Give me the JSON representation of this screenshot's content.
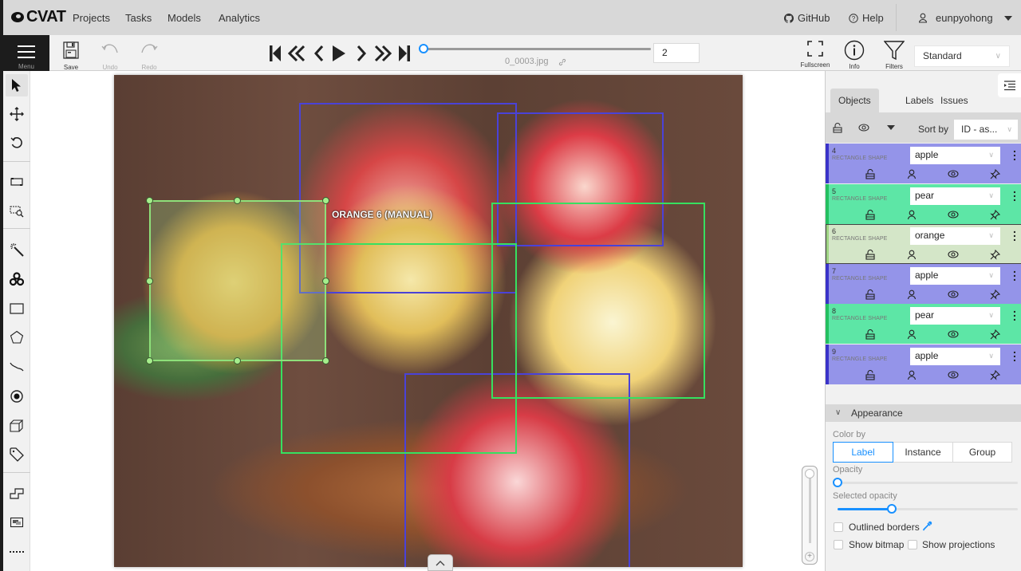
{
  "header": {
    "logo": "CVAT",
    "nav": [
      "Projects",
      "Tasks",
      "Models",
      "Analytics"
    ],
    "github": "GitHub",
    "help": "Help",
    "user": "eunpyohong"
  },
  "toolbar": {
    "menu_label": "Menu",
    "save_label": "Save",
    "undo_label": "Undo",
    "redo_label": "Redo",
    "frame_name": "0_0003.jpg",
    "frame_number": "2",
    "frame_progress_fraction": 0.0,
    "fullscreen_label": "Fullscreen",
    "info_label": "Info",
    "filters_label": "Filters",
    "workspace": "Standard"
  },
  "canvas": {
    "selected_label_text": "ORANGE 6 (MANUAL)",
    "colors": {
      "apple": "#4a42d8",
      "pear": "#36e060",
      "orange": "#8ee07a"
    }
  },
  "sidebar": {
    "tabs": [
      "Objects",
      "Labels",
      "Issues"
    ],
    "active_tab": "Objects",
    "sort_by_label": "Sort by",
    "sort_by_value": "ID - as...",
    "objects": [
      {
        "id": "4",
        "type": "RECTANGLE SHAPE",
        "label": "apple",
        "color": "#9494e9",
        "border": "#3a33c9"
      },
      {
        "id": "5",
        "type": "RECTANGLE SHAPE",
        "label": "pear",
        "color": "#5de6a6",
        "border": "#24c060"
      },
      {
        "id": "6",
        "type": "RECTANGLE SHAPE",
        "label": "orange",
        "color": "#d4e6c8",
        "border": "#9ed483"
      },
      {
        "id": "7",
        "type": "RECTANGLE SHAPE",
        "label": "apple",
        "color": "#9494e9",
        "border": "#3a33c9"
      },
      {
        "id": "8",
        "type": "RECTANGLE SHAPE",
        "label": "pear",
        "color": "#5de6a6",
        "border": "#24c060"
      },
      {
        "id": "9",
        "type": "RECTANGLE SHAPE",
        "label": "apple",
        "color": "#9494e9",
        "border": "#3a33c9"
      }
    ],
    "appearance": {
      "title": "Appearance",
      "color_by_label": "Color by",
      "color_by_options": [
        "Label",
        "Instance",
        "Group"
      ],
      "color_by_selected": "Label",
      "opacity_label": "Opacity",
      "opacity_value": 0.0,
      "selected_opacity_label": "Selected opacity",
      "selected_opacity_value": 0.3,
      "outlined_borders_label": "Outlined borders",
      "outlined_borders_checked": false,
      "show_bitmap_label": "Show bitmap",
      "show_bitmap_checked": false,
      "show_projections_label": "Show projections",
      "show_projections_checked": false
    }
  }
}
